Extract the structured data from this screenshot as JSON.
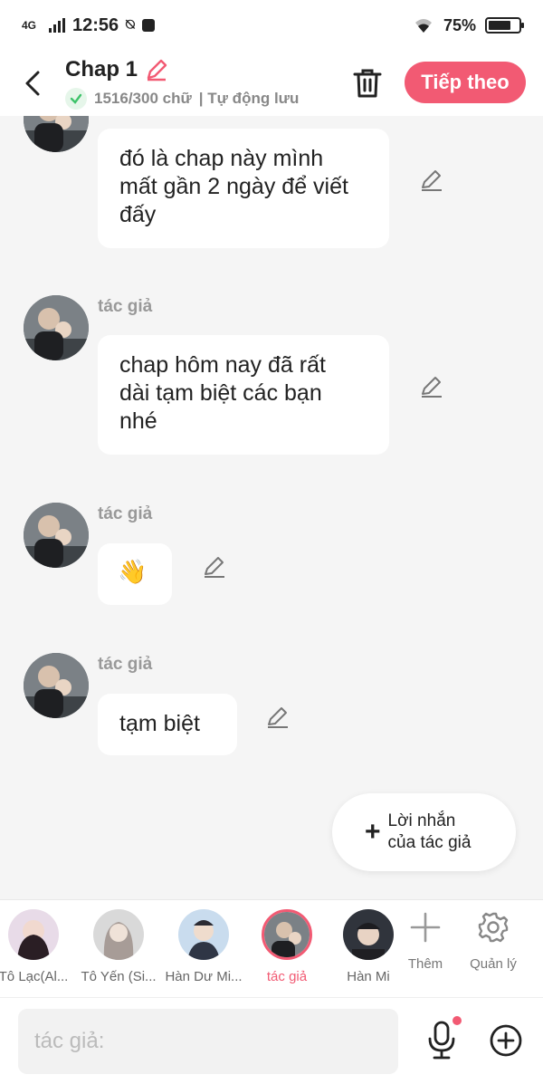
{
  "status": {
    "network": "4G",
    "time": "12:56",
    "battery": "75%",
    "battery_level": 0.75
  },
  "header": {
    "title": "Chap 1",
    "word_count": "1516/300 chữ",
    "autosave": "| Tự động lưu",
    "next_label": "Tiếp theo"
  },
  "messages": [
    {
      "author": "",
      "text": "đó là chap này mình\nmất gần 2 ngày để viết\nđấy"
    },
    {
      "author": "tác giả",
      "text": "chap hôm nay đã rất\ndài tạm biệt các bạn\nnhé"
    },
    {
      "author": "tác giả",
      "text": "👋"
    },
    {
      "author": "tác giả",
      "text": "tạm biệt"
    }
  ],
  "note_button": {
    "label": "Lời nhắn\ncủa tác giả"
  },
  "characters": [
    {
      "name": "Tô Lạc(Al..."
    },
    {
      "name": "Tô Yến (Si..."
    },
    {
      "name": "Hàn Dư Mi..."
    },
    {
      "name": "tác giả"
    },
    {
      "name": "Hàn Mi"
    }
  ],
  "tools": {
    "more_label": "Thêm",
    "manage_label": "Quản lý"
  },
  "input": {
    "placeholder": "tác giả:"
  },
  "colors": {
    "accent": "#f25a73",
    "background": "#f5f5f5",
    "check": "#3ec36a"
  }
}
